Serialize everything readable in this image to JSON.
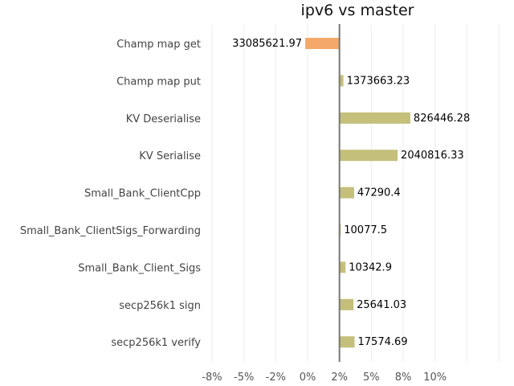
{
  "chart_data": {
    "type": "bar",
    "orientation": "horizontal",
    "title": "ipv6 vs master",
    "xlabel": "",
    "ylabel": "",
    "xlim": [
      -0.08,
      0.1
    ],
    "x_ticks": [
      -0.08,
      -0.06,
      -0.04,
      -0.02,
      0,
      0.02,
      0.04,
      0.06,
      0.08,
      0.1
    ],
    "x_tick_labels": [
      "-8%",
      "-5%",
      "-2%",
      "0%",
      "2%",
      "5%",
      "8%",
      "10%"
    ],
    "grid": "vertical",
    "categories": [
      "Champ map get",
      "Champ map put",
      "KV Deserialise",
      "KV Serialise",
      "Small_Bank_ClientCpp",
      "Small_Bank_ClientSigs_Forwarding",
      "Small_Bank_Client_Sigs",
      "secp256k1 sign",
      "secp256k1 verify"
    ],
    "values": [
      -0.0215,
      0.0025,
      0.0445,
      0.0365,
      0.0092,
      0.0008,
      0.0038,
      0.0088,
      0.0095
    ],
    "value_labels": [
      "33085621.97",
      "1373663.23",
      "826446.28",
      "2040816.33",
      "47290.4",
      "10077.5",
      "10342.9",
      "25641.03",
      "17574.69"
    ],
    "colors": {
      "positive": "#c4bf7a",
      "negative": "#f4a96a",
      "grid": "#eeeeee",
      "zero_line": "#777777"
    }
  }
}
